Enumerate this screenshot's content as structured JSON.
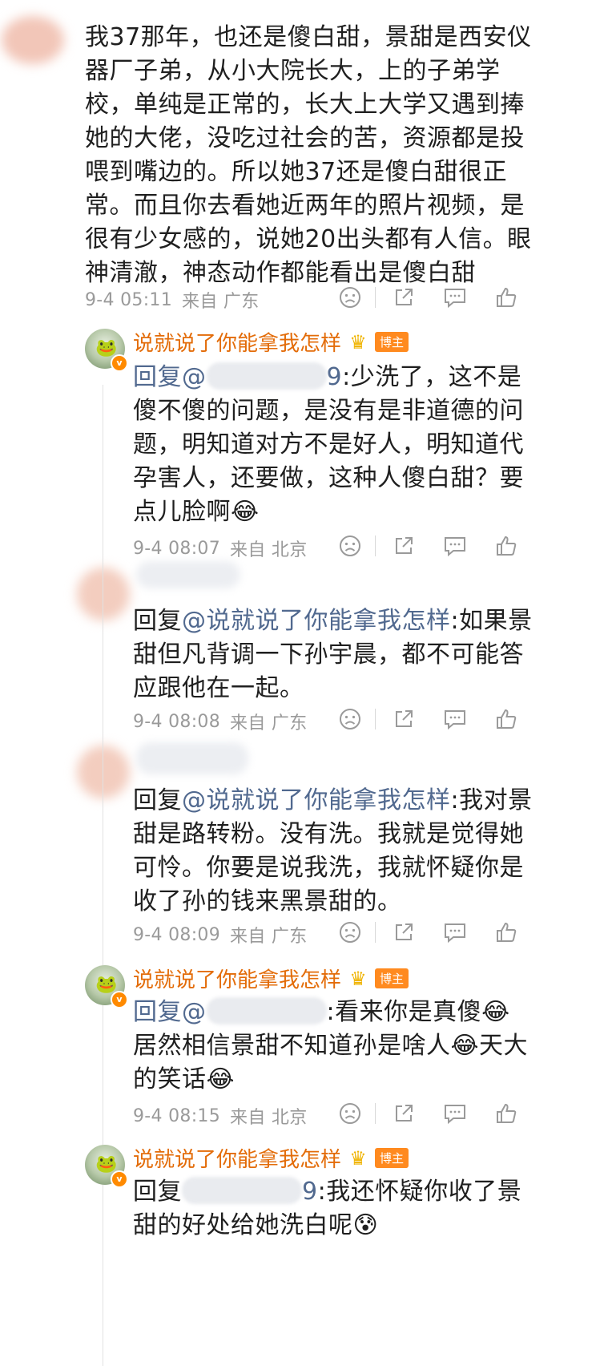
{
  "comments": [
    {
      "body": "我37那年，也还是傻白甜，景甜是西安仪器厂子弟，从小大院长大，上的子弟学校，单纯是正常的，长大上大学又遇到捧她的大佬，没吃过社会的苦，资源都是投喂到嘴边的。所以她37还是傻白甜很正常。而且你去看她近两年的照片视频，是很有少女感的，说她20出头都有人信。眼神清澈，神态动作都能看出是傻白甜",
      "date": "9-4 05:11",
      "source": "来自 广东"
    },
    {
      "username": "说就说了你能拿我怎样",
      "author_tag": "博主",
      "reply_prefix": "回复@",
      "mention_tail": "9",
      "body": ":少洗了，这不是傻不傻的问题，是没有是非道德的问题，明知道对方不是好人，明知道代孕害人，还要做，这种人傻白甜？要点儿脸啊😂",
      "date": "9-4 08:07",
      "source": "来自 北京"
    },
    {
      "reply_prefix": "回复",
      "mention": "@说就说了你能拿我怎样",
      "body": ":如果景甜但凡背调一下孙宇晨，都不可能答应跟他在一起。",
      "date": "9-4 08:08",
      "source": "来自 广东"
    },
    {
      "reply_prefix": "回复",
      "mention": "@说就说了你能拿我怎样",
      "body": ":我对景甜是路转粉。没有洗。我就是觉得她可怜。你要是说我洗，我就怀疑你是收了孙的钱来黑景甜的。",
      "date": "9-4 08:09",
      "source": "来自 广东"
    },
    {
      "username": "说就说了你能拿我怎样",
      "author_tag": "博主",
      "reply_prefix": "回复@",
      "body": ":看来你是真傻😂居然相信景甜不知道孙是啥人😂天大的笑话😂",
      "date": "9-4 08:15",
      "source": "来自 北京"
    },
    {
      "username": "说就说了你能拿我怎样",
      "author_tag": "博主",
      "reply_prefix": "回复",
      "mention_tail": "9",
      "body": ":我还怀疑你收了景甜的好处给她洗白呢😰"
    }
  ],
  "icons": [
    "frown-icon",
    "share-icon",
    "comment-icon",
    "like-icon"
  ]
}
